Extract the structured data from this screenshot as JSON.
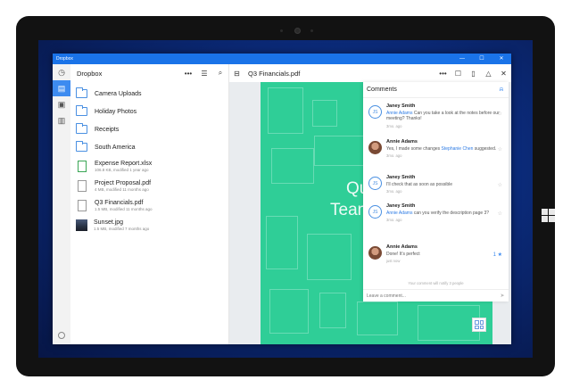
{
  "window": {
    "title": "Dropbox",
    "controls": {
      "minimize": "—",
      "maximize": "☐",
      "close": "✕"
    }
  },
  "left_rail": {
    "icons": [
      "history-icon",
      "files-icon",
      "photos-icon",
      "offline-icon"
    ],
    "settings_icon": "gear-icon"
  },
  "file_pane": {
    "header": {
      "label": "Dropbox",
      "more": "•••",
      "sort": "☰",
      "search": "⌕"
    },
    "items": [
      {
        "name": "Camera Uploads",
        "type": "folder"
      },
      {
        "name": "Holiday Photos",
        "type": "folder"
      },
      {
        "name": "Receipts",
        "type": "folder"
      },
      {
        "name": "South America",
        "type": "folder"
      },
      {
        "name": "Expense Report.xlsx",
        "type": "file",
        "meta": "106.8 KB, modified 1 year ago"
      },
      {
        "name": "Project Proposal.pdf",
        "type": "file",
        "meta": "4 MB, modified 11 months ago"
      },
      {
        "name": "Q3 Financials.pdf",
        "type": "file",
        "meta": "1.5 MB, modified 11 months ago"
      },
      {
        "name": "Sunset.jpg",
        "type": "image",
        "meta": "1.5 MB, modified 7 months ago"
      }
    ]
  },
  "viewer": {
    "header": {
      "file_name": "Q3 Financials.pdf",
      "more": "•••",
      "comment": "☐",
      "share": "▯",
      "open": "△",
      "close": "✕"
    },
    "pdf_title_line1": "Qua",
    "pdf_title_line2": "Team",
    "page_color": "#2fce97"
  },
  "comments": {
    "title": "Comments",
    "bell": "🔔",
    "items": [
      {
        "author": "Janey Smith",
        "initials": "JS",
        "mention": "Annie Adams",
        "text": " Can you take a look at the notes before our meeting? Thanks!",
        "time": "3mo. ago"
      },
      {
        "author": "Annie Adams",
        "text_before": "Yes, I made some changes ",
        "mention": "Stephanie Chen",
        "text_after": " suggested.",
        "time": "3mo. ago"
      },
      {
        "author": "Janey Smith",
        "initials": "JS",
        "text": "I'll check that as soon as possible",
        "time": "3mo. ago"
      },
      {
        "author": "Janey Smith",
        "initials": "JS",
        "mention": "Annie Adams",
        "text": " can you verify the description page 3?",
        "time": "3mo. ago"
      },
      {
        "author": "Annie Adams",
        "text": "Done! It's perfect",
        "time": "just now",
        "like_count": "1"
      }
    ],
    "seen_note": "Your comment will notify 3 people",
    "input_placeholder": "Leave a comment...",
    "send": "➤"
  },
  "accent": "#1a73e8"
}
